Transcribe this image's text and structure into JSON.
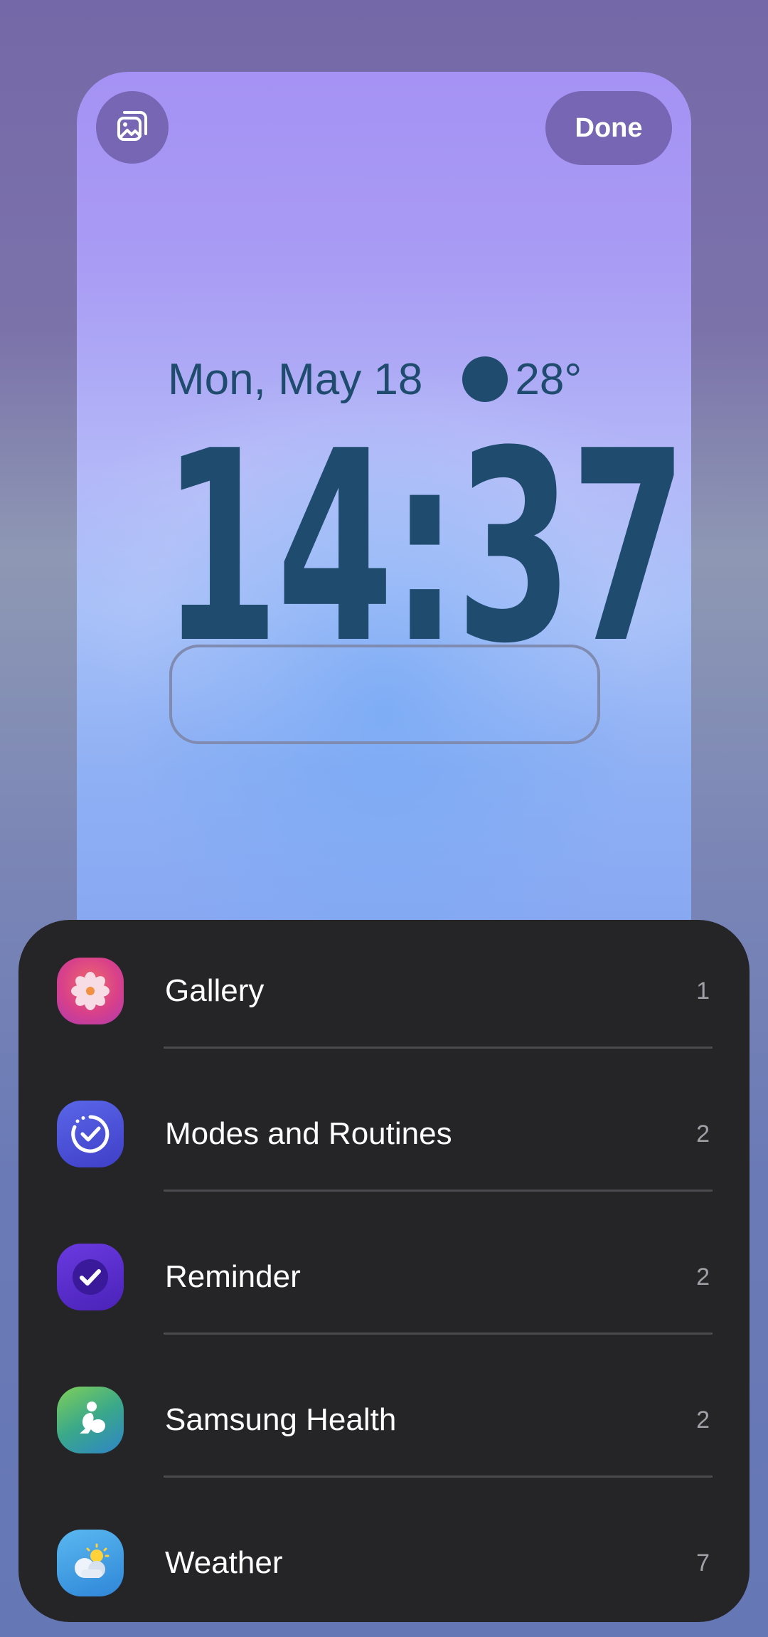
{
  "preview": {
    "done_label": "Done",
    "wallpaper_icon": "wallpaper-icon",
    "date": "Mon, May 18",
    "temperature": "28°",
    "time": "14:37"
  },
  "widget_apps": [
    {
      "name": "Gallery",
      "count": "1",
      "icon": "gallery-icon",
      "color": "#e0407a"
    },
    {
      "name": "Modes and Routines",
      "count": "2",
      "icon": "modes-routines-icon",
      "color": "#4a52d8"
    },
    {
      "name": "Reminder",
      "count": "2",
      "icon": "reminder-icon",
      "color": "#5a2fd0"
    },
    {
      "name": "Samsung Health",
      "count": "2",
      "icon": "samsung-health-icon",
      "color": "#3aa88a"
    },
    {
      "name": "Weather",
      "count": "7",
      "icon": "weather-icon",
      "color": "#3f9fe0"
    }
  ],
  "colors": {
    "clock_text": "#1f4b6e",
    "sheet_background": "#252528",
    "button_background": "#7766b4"
  }
}
